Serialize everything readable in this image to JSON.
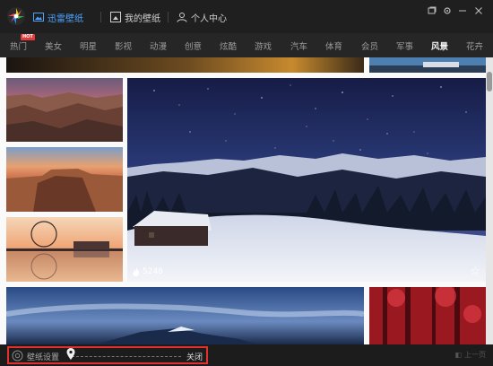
{
  "app": {
    "tabs": [
      {
        "label": "迅雷壁纸",
        "icon": "image-icon",
        "active": true
      },
      {
        "label": "我的壁纸",
        "icon": "image-frame-icon",
        "active": false
      },
      {
        "label": "个人中心",
        "icon": "user-icon",
        "active": false
      }
    ],
    "window_controls": [
      "restore-icon",
      "settings-icon",
      "minimize-icon",
      "close-icon"
    ]
  },
  "categories": [
    {
      "label": "热门",
      "badge": "HOT"
    },
    {
      "label": "美女"
    },
    {
      "label": "明星"
    },
    {
      "label": "影视"
    },
    {
      "label": "动漫"
    },
    {
      "label": "创意"
    },
    {
      "label": "炫酷"
    },
    {
      "label": "游戏"
    },
    {
      "label": "汽车"
    },
    {
      "label": "体育"
    },
    {
      "label": "会员"
    },
    {
      "label": "军事"
    },
    {
      "label": "风景",
      "active": true
    },
    {
      "label": "花卉"
    }
  ],
  "featured": {
    "likes": "5248",
    "like_icon": "fire-icon",
    "favorite_icon": "star-icon"
  },
  "bottom": {
    "settings_label": "壁纸设置",
    "toggle_label": "关闭",
    "prev_page": "上一页"
  },
  "colors": {
    "accent": "#4aa3ff",
    "highlight_border": "#e03030",
    "hot_badge": "#e23b3b"
  }
}
